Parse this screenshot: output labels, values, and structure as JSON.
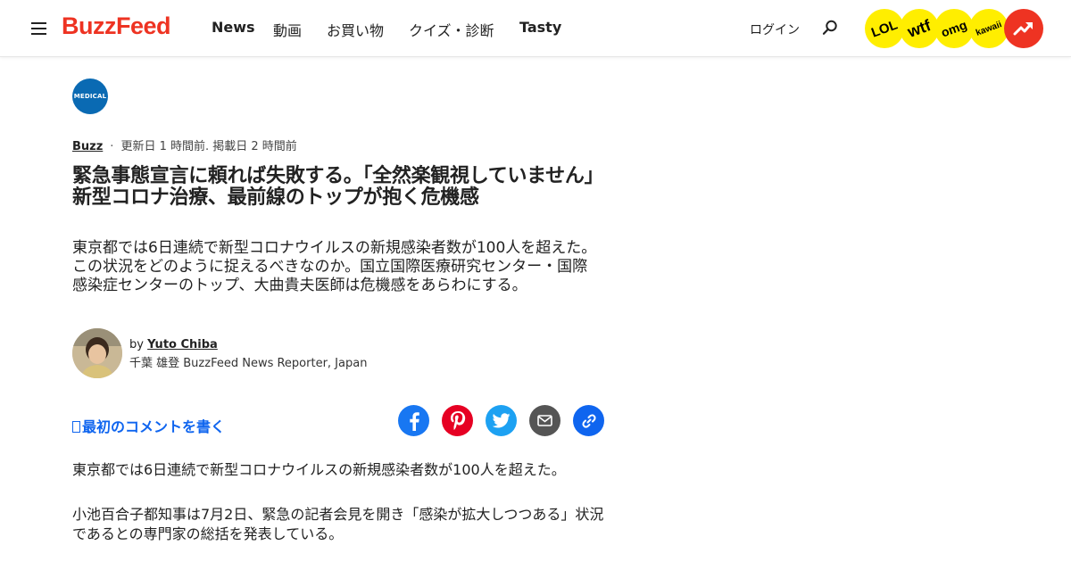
{
  "header": {
    "logo": "BuzzFeed",
    "nav": [
      {
        "label": "News",
        "bold": true
      },
      {
        "label": "動画",
        "bold": false
      },
      {
        "label": "お買い物",
        "bold": false
      },
      {
        "label": "クイズ・診断",
        "bold": false
      },
      {
        "label": "Tasty",
        "bold": true
      }
    ],
    "login": "ログイン",
    "badges": [
      {
        "label": "LOL",
        "icon": "lol-badge-icon"
      },
      {
        "label": "wtf",
        "icon": "wtf-badge-icon"
      },
      {
        "label": "omg",
        "icon": "omg-badge-icon"
      },
      {
        "label": "kawaii",
        "icon": "kawaii-badge-icon"
      },
      {
        "label": "",
        "icon": "trending-arrow-icon"
      }
    ]
  },
  "colors": {
    "brand_red": "#ee3322",
    "badge_yellow": "#ffee00",
    "link_blue": "#0f65ef",
    "medical_blue": "#0a6ab3",
    "facebook": "#1877f2",
    "pinterest": "#e60023",
    "twitter": "#1da1f2",
    "email": "#555555",
    "copy_link": "#0f65ef"
  },
  "article": {
    "category_badge": "MEDICAL",
    "section": "Buzz",
    "timestamp": "更新日 1 時間前. 掲載日 2 時間前",
    "title": "緊急事態宣言に頼れば失敗する。「全然楽観視していません」新型コロナ治療、最前線のトップが抱く危機感",
    "dek": "東京都では6日連続で新型コロナウイルスの新規感染者数が100人を超えた。この状況をどのように捉えるべきなのか。国立国際医療研究センター・国際感染症センターのトップ、大曲貴夫医師は危機感をあらわにする。",
    "byline_prefix": "by",
    "author": "Yuto Chiba",
    "author_role": "千葉 雄登 BuzzFeed News Reporter, Japan",
    "comment_cta": "最初のコメントを書く",
    "share_icons": [
      "facebook-icon",
      "pinterest-icon",
      "twitter-icon",
      "email-icon",
      "link-icon"
    ],
    "paragraphs": [
      "東京都では6日連続で新型コロナウイルスの新規感染者数が100人を超えた。",
      "小池百合子都知事は7月2日、緊急の記者会見を開き「感染が拡大しつつある」状況であるとの専門家の総括を発表している。"
    ]
  }
}
